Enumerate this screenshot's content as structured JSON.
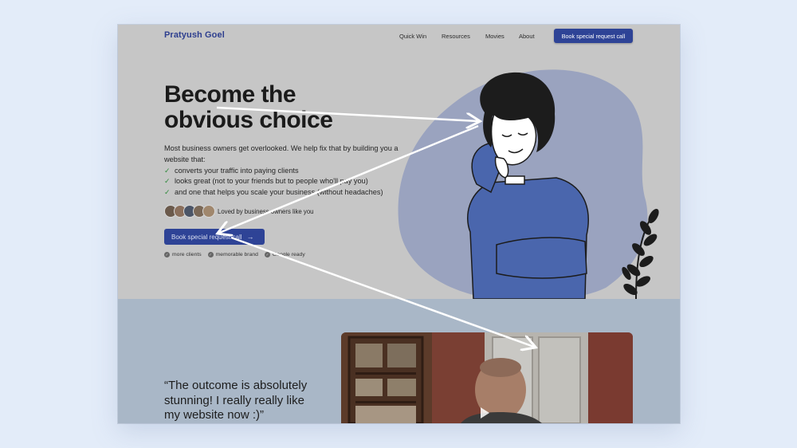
{
  "header": {
    "logo": "Pratyush Goel",
    "nav": [
      "Quick Win",
      "Resources",
      "Movies",
      "About"
    ],
    "cta": "Book special request call"
  },
  "hero": {
    "headline_line1": "Become the",
    "headline_line2": "obvious choice",
    "intro": "Most business owners get overlooked. We help fix that by building you a website that:",
    "checks": [
      "converts your traffic into paying clients",
      "looks great (not to your friends but to people who'll pay you)",
      "and one that helps you scale your business (without headaches)"
    ],
    "social_proof": "Loved by business owners like you",
    "cta": "Book special request call",
    "badges": [
      "more clients",
      "memorable brand",
      "Google ready"
    ]
  },
  "testimonial": {
    "quote_line1": "“The outcome is absolutely",
    "quote_line2": "stunning! I really really like",
    "quote_line3": "my website now :)”"
  },
  "colors": {
    "accent": "#2e4396",
    "brand_text": "#2e3f8f",
    "blob": "#9aa3bf",
    "sweater": "#4a66ad",
    "arrow": "#ffffff"
  }
}
